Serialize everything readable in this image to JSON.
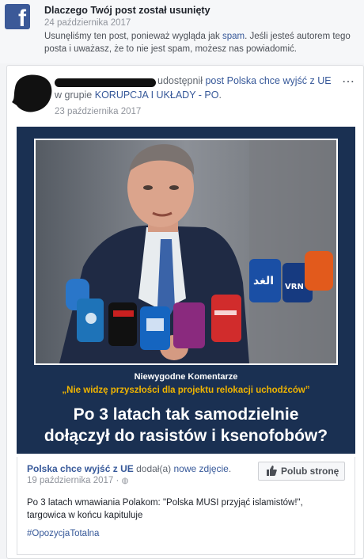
{
  "notice": {
    "title": "Dlaczego Twój post został usunięty",
    "date": "24 października 2017",
    "body_start": "Usunęliśmy ten post, ponieważ wygląda jak ",
    "body_link": "spam",
    "body_end": ". Jeśli jesteś autorem tego posta i uważasz, że to nie jest spam, możesz nas powiadomić."
  },
  "post": {
    "shared_word": "udostępnił",
    "post_link": "post",
    "page_link": "Polska chce wyjść z UE",
    "in_group": "w grupie",
    "group_link": "KORUPCJA I UKŁADY - PO",
    "date": "23 października 2017",
    "more_icon": "⋯"
  },
  "image": {
    "mic_labels": [
      "الغد",
      "VRN"
    ],
    "subtitle": "Niewygodne Komentarze",
    "quote": "„Nie widzę przyszłości dla projektu relokacji uchodźców”",
    "headline_1": "Po 3 latach tak samodzielnie",
    "headline_2": "dołączył do rasistów i ksenofobów?"
  },
  "shared": {
    "page_name": "Polska chce wyjść z UE",
    "added": "dodał(a)",
    "new_photo": "nowe zdjęcie",
    "date": "19 października 2017 ·",
    "like_button": "Polub stronę",
    "text": "Po 3 latach wmawiania Polakom: \"Polska MUSI przyjąć islamistów!\", targowica w końcu kapituluje",
    "hashtag": "#OpozycjaTotalna"
  },
  "colors": {
    "facebook_blue": "#3b5998",
    "link": "#365899",
    "image_bg": "#1a3052",
    "quote": "#f0b400"
  }
}
